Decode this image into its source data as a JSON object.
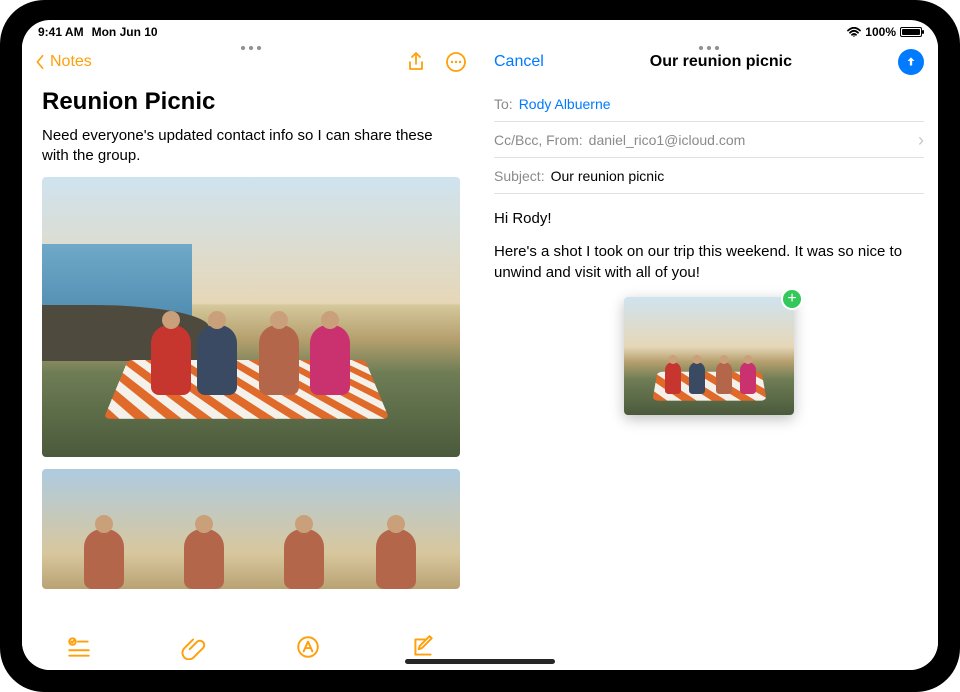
{
  "statusbar": {
    "time": "9:41 AM",
    "date": "Mon Jun 10",
    "battery_pct": "100%"
  },
  "notes": {
    "back_label": "Notes",
    "title": "Reunion Picnic",
    "body": "Need everyone's updated contact info so I can share these with the group.",
    "toolbar": {
      "checklist": "checklist",
      "attach": "attach",
      "markup": "markup",
      "compose": "compose"
    }
  },
  "mail": {
    "cancel": "Cancel",
    "title": "Our reunion picnic",
    "to_label": "To:",
    "to_value": "Rody Albuerne",
    "cc_label": "Cc/Bcc, From:",
    "cc_value": "daniel_rico1@icloud.com",
    "subject_label": "Subject:",
    "subject_value": "Our reunion picnic",
    "greeting": "Hi Rody!",
    "body": "Here's a shot I took on our trip this weekend. It was so nice to unwind and visit with all of you!"
  },
  "colors": {
    "notes_accent": "#ff9f0a",
    "mail_accent": "#007aff",
    "add_badge": "#34c759"
  }
}
